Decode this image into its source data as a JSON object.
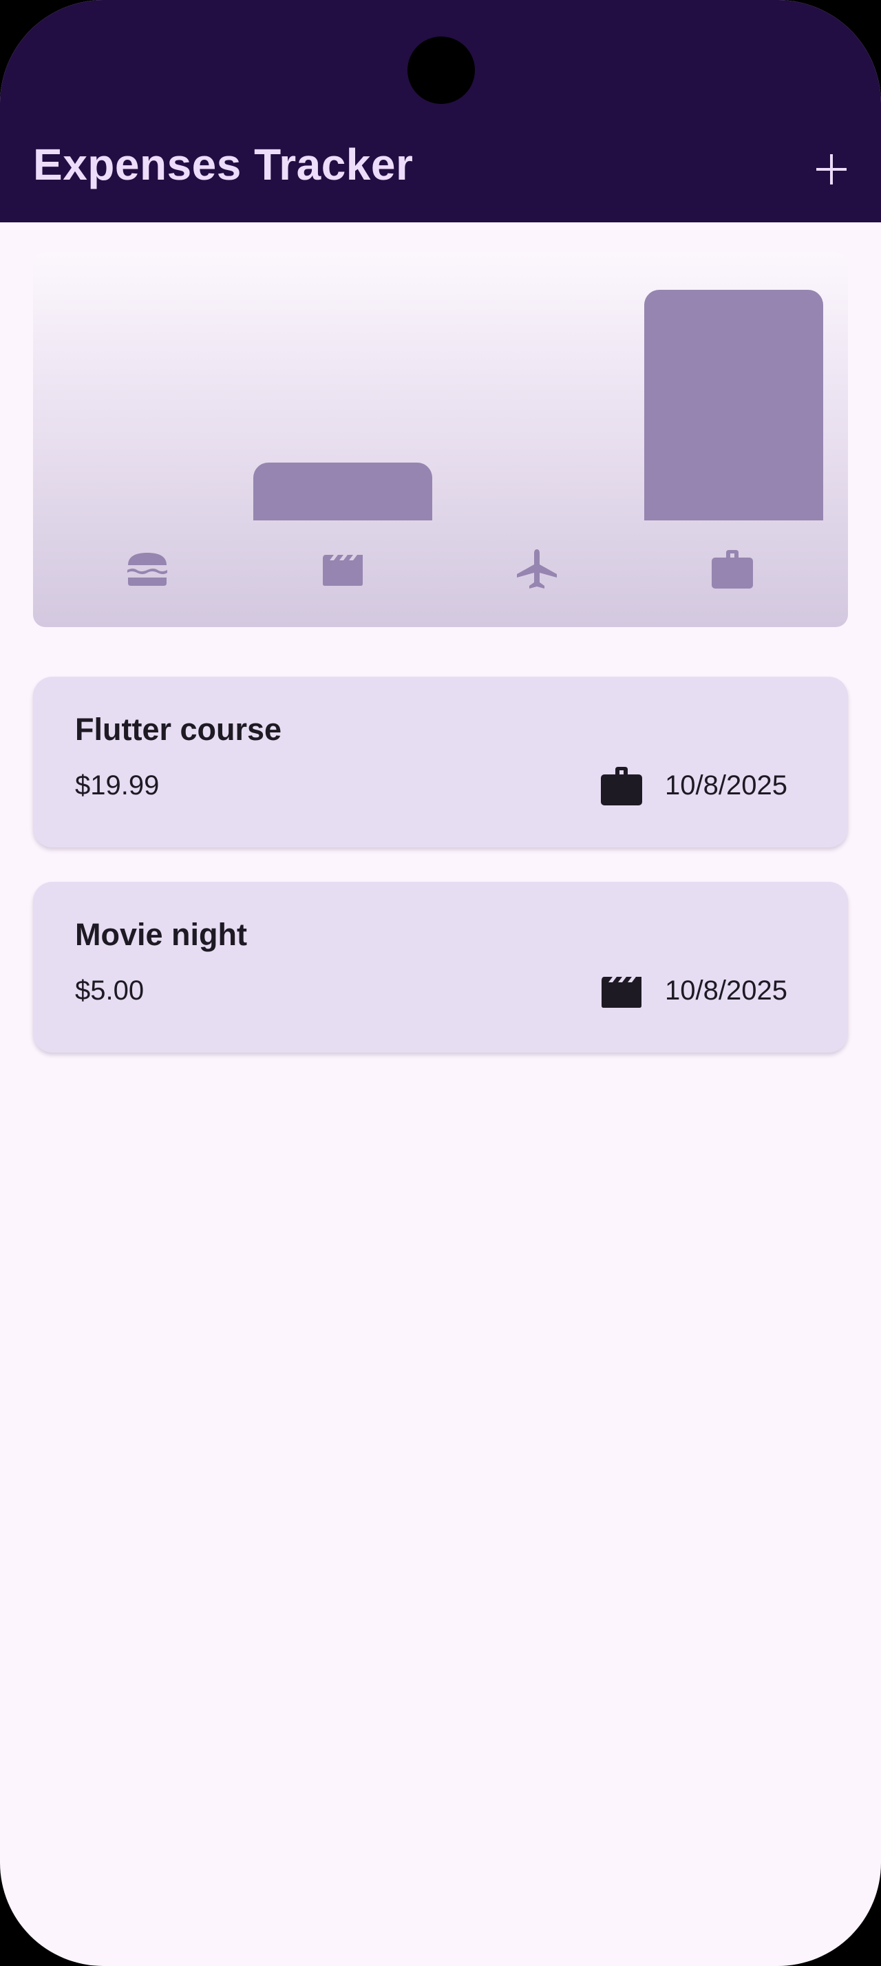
{
  "app": {
    "title": "Expenses Tracker",
    "add_icon": "plus-icon"
  },
  "colors": {
    "appbar": "#220e42",
    "title_text": "#eedcfb",
    "background": "#fcf5fd",
    "bar": "#9585b0",
    "card": "#e7ddf3",
    "text": "#1e1a24"
  },
  "chart_data": {
    "type": "bar",
    "categories": [
      "food",
      "leisure",
      "travel",
      "work"
    ],
    "category_icons": [
      "burger-icon",
      "movie-clapper-icon",
      "airplane-icon",
      "briefcase-icon"
    ],
    "values": [
      0,
      5.0,
      0,
      19.99
    ],
    "title": "",
    "xlabel": "",
    "ylabel": ""
  },
  "expenses": [
    {
      "title": "Flutter course",
      "amount": "$19.99",
      "category_icon": "briefcase-icon",
      "date": "10/8/2025"
    },
    {
      "title": "Movie night",
      "amount": "$5.00",
      "category_icon": "movie-clapper-icon",
      "date": "10/8/2025"
    }
  ]
}
